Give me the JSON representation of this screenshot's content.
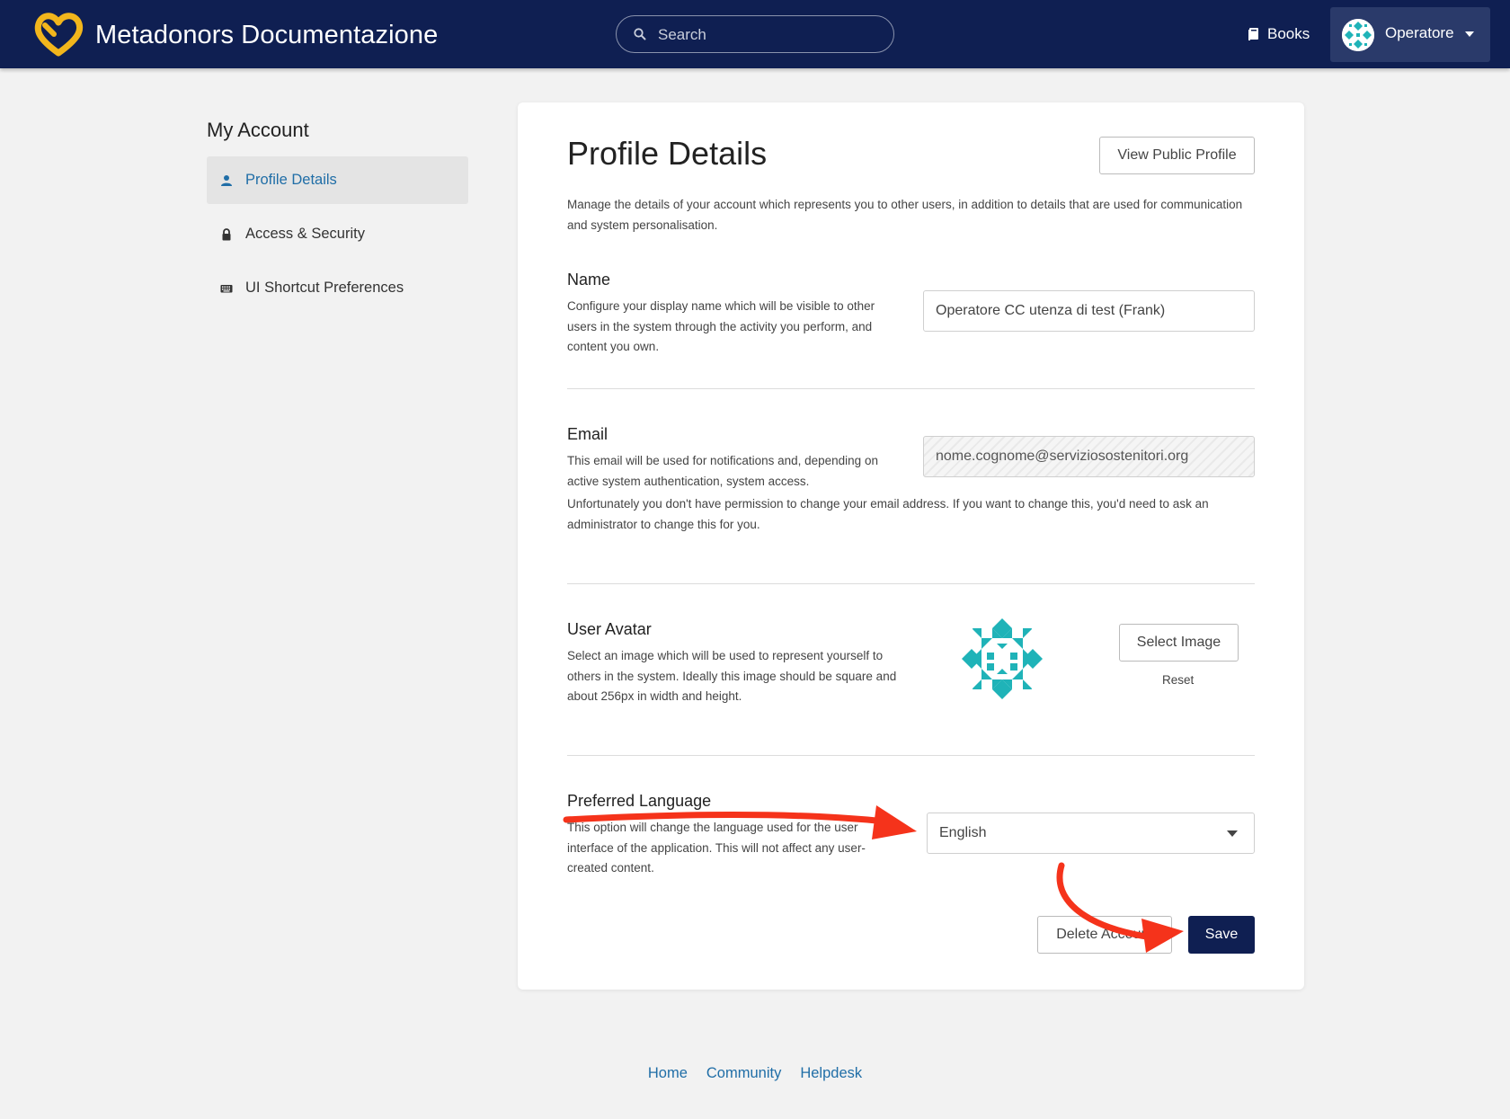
{
  "header": {
    "app_title": "Metadonors Documentazione",
    "search_placeholder": "Search",
    "books_label": "Books",
    "user_name": "Operatore",
    "logo_color": "#f2b61c",
    "bar_color": "#0f1f52"
  },
  "sidebar": {
    "title": "My Account",
    "items": [
      {
        "label": "Profile Details",
        "icon": "person-icon",
        "active": true
      },
      {
        "label": "Access & Security",
        "icon": "lock-icon",
        "active": false
      },
      {
        "label": "UI Shortcut Preferences",
        "icon": "keyboard-icon",
        "active": false
      }
    ]
  },
  "profile": {
    "title": "Profile Details",
    "view_public_label": "View Public Profile",
    "intro": "Manage the details of your account which represents you to other users, in addition to details that are used for communication and system personalisation.",
    "name": {
      "label": "Name",
      "description": "Configure your display name which will be visible to other users in the system through the activity you perform, and content you own.",
      "value": "Operatore CC utenza di test (Frank)"
    },
    "email": {
      "label": "Email",
      "description": "This email will be used for notifications and, depending on active system authentication, system access.",
      "value": "nome.cognome@serviziosostenitori.org",
      "permission_note": "Unfortunately you don't have permission to change your email address. If you want to change this, you'd need to ask an administrator to change this for you."
    },
    "avatar": {
      "label": "User Avatar",
      "description": "Select an image which will be used to represent yourself to others in the system. Ideally this image should be square and about 256px in width and height.",
      "select_label": "Select Image",
      "reset_label": "Reset",
      "color": "#1fb3b8"
    },
    "language": {
      "label": "Preferred Language",
      "description": "This option will change the language used for the user interface of the application. This will not affect any user-created content.",
      "selected": "English"
    },
    "delete_label": "Delete Account",
    "save_label": "Save"
  },
  "footer": {
    "links": [
      "Home",
      "Community",
      "Helpdesk"
    ]
  },
  "annotations": {
    "arrow_color": "#f5331b"
  }
}
